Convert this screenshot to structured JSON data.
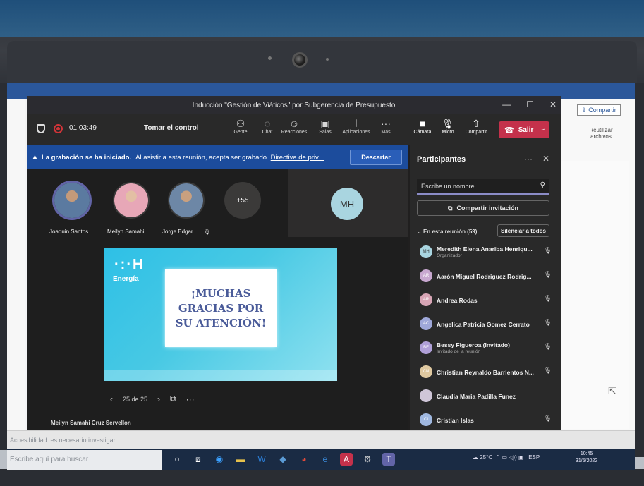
{
  "teams": {
    "window_title": "Inducción \"Gestión de Viáticos\" por Subgerencia de Presupuesto",
    "timer": "01:03:49",
    "take_control": "Tomar el control",
    "toolbar": {
      "people": "Gente",
      "chat": "Chat",
      "reactions": "Reacciones",
      "rooms": "Salas",
      "apps": "Aplicaciones",
      "more": "Más",
      "camera": "Cámara",
      "mic": "Micro",
      "share": "Compartir",
      "leave": "Salir"
    },
    "banner": {
      "title": "La grabación se ha iniciado.",
      "text": "Al asistir a esta reunión, acepta ser grabado.",
      "link": "Directiva de priv...",
      "dismiss": "Descartar"
    },
    "stage": {
      "participants": [
        {
          "name": "Joaquin Santos"
        },
        {
          "name": "Meilyn Samahi ..."
        },
        {
          "name": "Jorge Edgar..."
        }
      ],
      "more_count": "+55",
      "mh_initials": "MH",
      "slide": {
        "logo": "·:·H",
        "brand": "Energía",
        "message": "¡MUCHAS GRACIAS POR SU ATENCIÓN!"
      },
      "slide_counter": "25 de 25",
      "presenter_name": "Meilyn Samahi Cruz Servellon"
    },
    "panel": {
      "title": "Participantes",
      "search_placeholder": "Escribe un nombre",
      "share_invite": "Compartir invitación",
      "in_meeting": "En esta reunión (59)",
      "mute_all": "Silenciar a todos",
      "people": [
        {
          "initials": "MH",
          "name": "Meredith Elena Anariba Henriqu...",
          "sub": "Organizador",
          "color": "#a9d5e0"
        },
        {
          "initials": "AR",
          "name": "Aarón Miguel Rodriguez Rodrig...",
          "sub": "",
          "color": "#c8a8d0"
        },
        {
          "initials": "AR",
          "name": "Andrea Rodas",
          "sub": "",
          "color": "#d7a5b5"
        },
        {
          "initials": "AC",
          "name": "Angelica Patricia Gomez Cerrato",
          "sub": "",
          "color": "#9fa8da"
        },
        {
          "initials": "BF",
          "name": "Bessy Figueroa (Invitado)",
          "sub": "Invitado de la reunión",
          "color": "#b0a0d8"
        },
        {
          "initials": "CN",
          "name": "Christian Reynaldo Barrientos N...",
          "sub": "",
          "color": "#e0c9a0"
        },
        {
          "initials": "",
          "name": "Claudia Maria Padilla Funez",
          "sub": "",
          "color": "#cfc6d8"
        },
        {
          "initials": "CI",
          "name": "Cristian Islas",
          "sub": "",
          "color": "#a0b8e0"
        }
      ]
    }
  },
  "word": {
    "share": "Compartir",
    "reuse_files": "Reutilizar archivos",
    "status": "Accesibilidad: es necesario investigar",
    "search_taskbar": "Escribe aquí para buscar"
  },
  "system": {
    "weather": "25°C",
    "lang": "ESP",
    "time": "10:45",
    "date": "31/5/2022"
  }
}
